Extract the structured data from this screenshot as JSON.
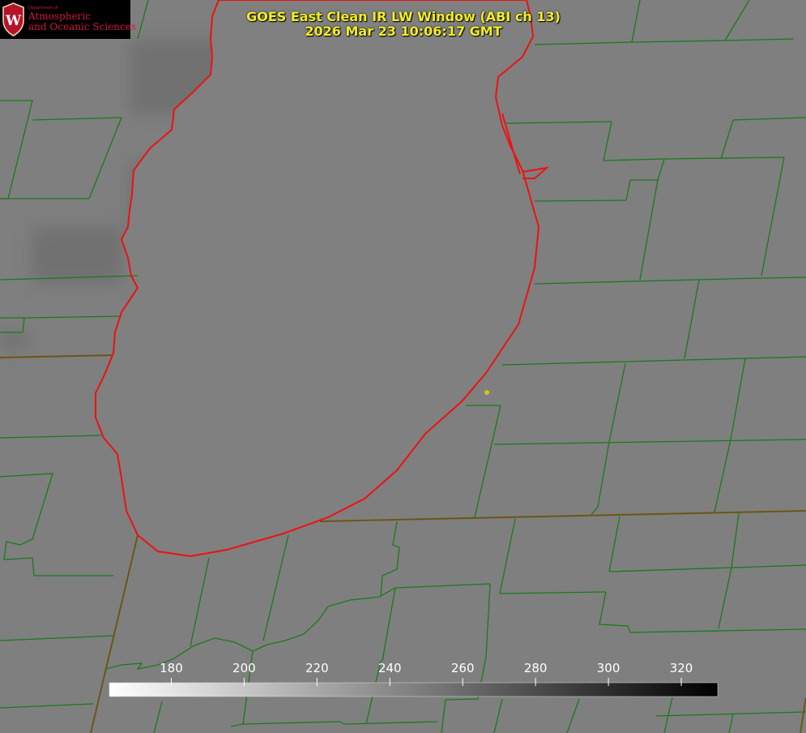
{
  "title": {
    "line1": "GOES East Clean IR LW Window (ABI ch 13)",
    "line2": "2026 Mar 23 10:06:17 GMT"
  },
  "logo": {
    "department_line": "Department of",
    "name_line1": "Atmospheric",
    "name_line2": "and Oceanic Sciences",
    "emblem_letter": "W"
  },
  "colorbar": {
    "ticks": [
      180,
      200,
      220,
      240,
      260,
      280,
      300,
      320
    ],
    "range": [
      163,
      330
    ],
    "gradient": "white-to-black"
  },
  "colors": {
    "background": "#7f7f7f",
    "lake": "#808080",
    "county_lines": "#1a7a1a",
    "state_lines": "#a04010",
    "shoreline_highlight": "#ee1111",
    "title_text": "#f2ee22",
    "logo_red": "#d0183a",
    "marker": "#d4c21a"
  },
  "map": {
    "lake_shore": [
      [
        270,
        0
      ],
      [
        262,
        20
      ],
      [
        260,
        48
      ],
      [
        262,
        70
      ],
      [
        260,
        92
      ],
      [
        240,
        112
      ],
      [
        215,
        135
      ],
      [
        212,
        160
      ],
      [
        185,
        183
      ],
      [
        165,
        210
      ],
      [
        163,
        240
      ],
      [
        160,
        260
      ],
      [
        158,
        280
      ],
      [
        150,
        295
      ],
      [
        158,
        318
      ],
      [
        162,
        340
      ],
      [
        170,
        355
      ],
      [
        150,
        385
      ],
      [
        142,
        410
      ],
      [
        140,
        435
      ],
      [
        130,
        460
      ],
      [
        118,
        485
      ],
      [
        118,
        515
      ],
      [
        128,
        540
      ],
      [
        145,
        560
      ],
      [
        150,
        590
      ],
      [
        156,
        630
      ],
      [
        170,
        660
      ],
      [
        195,
        680
      ],
      [
        235,
        686
      ],
      [
        280,
        678
      ],
      [
        350,
        658
      ],
      [
        405,
        638
      ],
      [
        450,
        615
      ],
      [
        490,
        580
      ],
      [
        525,
        535
      ],
      [
        570,
        495
      ],
      [
        600,
        460
      ],
      [
        620,
        430
      ],
      [
        640,
        400
      ],
      [
        660,
        330
      ],
      [
        665,
        280
      ],
      [
        655,
        245
      ],
      [
        645,
        210
      ],
      [
        630,
        180
      ],
      [
        620,
        155
      ],
      [
        612,
        120
      ],
      [
        615,
        95
      ],
      [
        645,
        70
      ],
      [
        658,
        45
      ],
      [
        655,
        20
      ],
      [
        650,
        0
      ]
    ],
    "state_lines": [
      [
        [
          0,
          441
        ],
        [
          140,
          438
        ]
      ],
      [
        [
          395,
          643
        ],
        [
          995,
          630
        ]
      ],
      [
        [
          170,
          660
        ],
        [
          112,
          904
        ]
      ],
      [
        [
          995,
          860
        ],
        [
          988,
          904
        ]
      ]
    ],
    "county_lines": [
      [
        [
          0,
          124
        ],
        [
          40,
          124
        ],
        [
          10,
          245
        ],
        [
          0,
          245
        ]
      ],
      [
        [
          0,
          245
        ],
        [
          110,
          245
        ]
      ],
      [
        [
          40,
          148
        ],
        [
          150,
          145
        ]
      ],
      [
        [
          150,
          145
        ],
        [
          110,
          245
        ]
      ],
      [
        [
          0,
          345
        ],
        [
          170,
          340
        ]
      ],
      [
        [
          0,
          392
        ],
        [
          30,
          392
        ],
        [
          28,
          410
        ],
        [
          0,
          410
        ]
      ],
      [
        [
          30,
          392
        ],
        [
          150,
          390
        ]
      ],
      [
        [
          0,
          540
        ],
        [
          125,
          537
        ]
      ],
      [
        [
          0,
          588
        ],
        [
          65,
          584
        ],
        [
          40,
          665
        ],
        [
          25,
          672
        ],
        [
          8,
          668
        ],
        [
          5,
          690
        ],
        [
          40,
          688
        ],
        [
          42,
          710
        ],
        [
          140,
          710
        ]
      ],
      [
        [
          0,
          790
        ],
        [
          140,
          784
        ]
      ],
      [
        [
          0,
          873
        ],
        [
          115,
          868
        ]
      ],
      [
        [
          108,
          48
        ],
        [
          128,
          0
        ]
      ],
      [
        [
          170,
          48
        ],
        [
          183,
          0
        ]
      ],
      [
        [
          660,
          55
        ],
        [
          780,
          52
        ]
      ],
      [
        [
          780,
          52
        ],
        [
          790,
          0
        ]
      ],
      [
        [
          780,
          52
        ],
        [
          895,
          50
        ]
      ],
      [
        [
          895,
          50
        ],
        [
          925,
          0
        ]
      ],
      [
        [
          895,
          50
        ],
        [
          980,
          48
        ]
      ],
      [
        [
          625,
          152
        ],
        [
          755,
          150
        ]
      ],
      [
        [
          755,
          150
        ],
        [
          745,
          198
        ]
      ],
      [
        [
          745,
          198
        ],
        [
          820,
          196
        ]
      ],
      [
        [
          905,
          148
        ],
        [
          995,
          145
        ]
      ],
      [
        [
          905,
          148
        ],
        [
          890,
          196
        ]
      ],
      [
        [
          820,
          196
        ],
        [
          968,
          194
        ]
      ],
      [
        [
          968,
          194
        ],
        [
          940,
          340
        ]
      ],
      [
        [
          820,
          196
        ],
        [
          812,
          222
        ]
      ],
      [
        [
          812,
          222
        ],
        [
          778,
          222
        ],
        [
          773,
          247
        ],
        [
          660,
          248
        ]
      ],
      [
        [
          812,
          222
        ],
        [
          790,
          345
        ]
      ],
      [
        [
          660,
          350
        ],
        [
          940,
          343
        ]
      ],
      [
        [
          940,
          343
        ],
        [
          995,
          342
        ]
      ],
      [
        [
          863,
          345
        ],
        [
          845,
          442
        ]
      ],
      [
        [
          620,
          450
        ],
        [
          995,
          440
        ]
      ],
      [
        [
          772,
          448
        ],
        [
          752,
          545
        ]
      ],
      [
        [
          920,
          442
        ],
        [
          902,
          542
        ]
      ],
      [
        [
          610,
          548
        ],
        [
          995,
          542
        ]
      ],
      [
        [
          618,
          500
        ],
        [
          575,
          500
        ]
      ],
      [
        [
          618,
          500
        ],
        [
          586,
          638
        ]
      ],
      [
        [
          752,
          545
        ],
        [
          738,
          625
        ],
        [
          730,
          635
        ]
      ],
      [
        [
          902,
          542
        ],
        [
          882,
          632
        ]
      ],
      [
        [
          490,
          643
        ],
        [
          485,
          672
        ],
        [
          493,
          675
        ],
        [
          490,
          702
        ],
        [
          472,
          710
        ],
        [
          470,
          735
        ]
      ],
      [
        [
          636,
          640
        ],
        [
          617,
          732
        ]
      ],
      [
        [
          765,
          637
        ],
        [
          752,
          705
        ]
      ],
      [
        [
          912,
          633
        ],
        [
          903,
          700
        ]
      ],
      [
        [
          752,
          705
        ],
        [
          995,
          697
        ]
      ],
      [
        [
          617,
          732
        ],
        [
          748,
          730
        ]
      ],
      [
        [
          748,
          730
        ],
        [
          740,
          770
        ],
        [
          775,
          772
        ],
        [
          778,
          780
        ],
        [
          995,
          776
        ]
      ],
      [
        [
          903,
          700
        ],
        [
          887,
          775
        ]
      ],
      [
        [
          470,
          735
        ],
        [
          488,
          725
        ],
        [
          605,
          720
        ]
      ],
      [
        [
          605,
          720
        ],
        [
          600,
          810
        ]
      ],
      [
        [
          488,
          725
        ],
        [
          472,
          815
        ]
      ],
      [
        [
          356,
          660
        ],
        [
          325,
          790
        ]
      ],
      [
        [
          258,
          688
        ],
        [
          235,
          797
        ]
      ],
      [
        [
          130,
          825
        ],
        [
          150,
          820
        ],
        [
          175,
          818
        ],
        [
          170,
          825
        ],
        [
          195,
          820
        ],
        [
          215,
          812
        ],
        [
          238,
          797
        ],
        [
          265,
          787
        ],
        [
          290,
          792
        ],
        [
          312,
          803
        ],
        [
          330,
          795
        ],
        [
          352,
          790
        ],
        [
          375,
          782
        ],
        [
          393,
          765
        ],
        [
          405,
          748
        ],
        [
          432,
          740
        ],
        [
          470,
          736
        ]
      ],
      [
        [
          312,
          803
        ],
        [
          300,
          893
        ]
      ],
      [
        [
          470,
          815
        ],
        [
          452,
          893
        ]
      ],
      [
        [
          600,
          810
        ],
        [
          590,
          862
        ]
      ],
      [
        [
          590,
          862
        ],
        [
          550,
          863
        ]
      ],
      [
        [
          200,
          865
        ],
        [
          190,
          904
        ]
      ],
      [
        [
          285,
          896
        ],
        [
          300,
          893
        ],
        [
          420,
          890
        ],
        [
          425,
          893
        ],
        [
          540,
          890
        ]
      ],
      [
        [
          550,
          863
        ],
        [
          545,
          904
        ]
      ],
      [
        [
          620,
          862
        ],
        [
          610,
          904
        ]
      ],
      [
        [
          715,
          862
        ],
        [
          700,
          904
        ]
      ],
      [
        [
          830,
          860
        ],
        [
          820,
          904
        ]
      ],
      [
        [
          810,
          883
        ],
        [
          995,
          878
        ]
      ],
      [
        [
          905,
          880
        ],
        [
          900,
          904
        ]
      ]
    ],
    "shore_highlights": [
      [
        [
          645,
          212
        ],
        [
          675,
          207
        ],
        [
          660,
          220
        ],
        [
          645,
          220
        ]
      ],
      [
        [
          620,
          140
        ],
        [
          642,
          215
        ]
      ]
    ],
    "marker": [
      601,
      484
    ],
    "cloud_patches": [
      [
        160,
        50,
        130,
        90
      ],
      [
        40,
        280,
        110,
        70
      ],
      [
        0,
        410,
        35,
        20
      ],
      [
        400,
        60,
        70,
        60
      ],
      [
        160,
        200,
        60,
        90
      ]
    ]
  }
}
